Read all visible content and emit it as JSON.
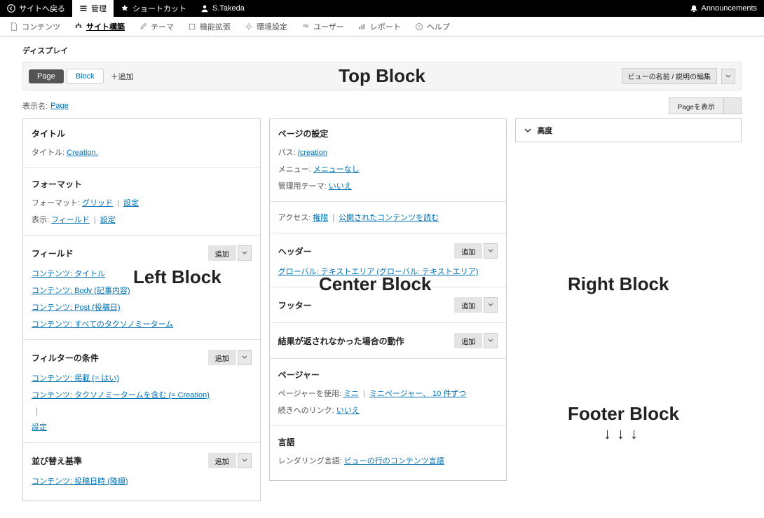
{
  "toolbar": {
    "back": "サイトへ戻る",
    "manage": "管理",
    "shortcuts": "ショートカット",
    "user": "S.Takeda",
    "announcements": "Announcements"
  },
  "subnav": {
    "content": "コンテンツ",
    "structure": "サイト構築",
    "theme": "テーマ",
    "extend": "機能拡張",
    "config": "環境設定",
    "users": "ユーザー",
    "reports": "レポート",
    "help": "ヘルプ"
  },
  "page_label": "ディスプレイ",
  "tabs": {
    "page": "Page",
    "block": "Block",
    "add": "＋追加"
  },
  "top_annot": "Top Block",
  "edit_name": "ビューの名前 / 説明の編集",
  "display_name": {
    "label": "表示名:",
    "value": "Page"
  },
  "show_page": "Pageを表示",
  "left": {
    "title_h": "タイトル",
    "title_k": "タイトル:",
    "title_v": "Creation.",
    "format_h": "フォーマット",
    "format_k": "フォーマット:",
    "format_v": "グリッド",
    "settings": "設定",
    "show_k": "表示:",
    "show_v": "フィールド",
    "fields_h": "フィールド",
    "add": "追加",
    "f1": "コンテンツ: タイトル",
    "f2": "コンテンツ: Body (記事内容)",
    "f3": "コンテンツ: Post (投稿日)",
    "f4": "コンテンツ: すべてのタクソノミーターム",
    "filter_h": "フィルターの条件",
    "fl1": "コンテンツ: 掲載 (= はい)",
    "fl2": "コンテンツ: タクソノミータームを含む (= Creation)",
    "sort_h": "並び替え基準",
    "s1": "コンテンツ: 投稿日時 (降順)"
  },
  "center": {
    "pg_h": "ページの設定",
    "path_k": "パス:",
    "path_v": "/creation",
    "menu_k": "メニュー:",
    "menu_v": "メニューなし",
    "admin_k": "管理用テーマ:",
    "admin_v": "いいえ",
    "access_k": "アクセス:",
    "access_v1": "権限",
    "access_v2": "公開されたコンテンツを読む",
    "header_h": "ヘッダー",
    "header_v": "グローバル: テキストエリア (グローバル: テキストエリア)",
    "footer_h": "フッター",
    "noresult_h": "結果が返されなかった場合の動作",
    "pager_h": "ページャー",
    "pager_k": "ページャーを使用:",
    "pager_v1": "ミニ",
    "pager_v2": "ミニページャー、 10 件ずつ",
    "more_k": "続きへのリンク:",
    "more_v": "いいえ",
    "lang_h": "言語",
    "lang_k": "レンダリング言語:",
    "lang_v": "ビューの行のコンテンツ言語",
    "add": "追加"
  },
  "right": {
    "advanced": "高度"
  },
  "annot": {
    "left": "Left Block",
    "center": "Center Block",
    "right": "Right Block",
    "footer": "Footer Block",
    "arrows": "↓↓↓"
  }
}
